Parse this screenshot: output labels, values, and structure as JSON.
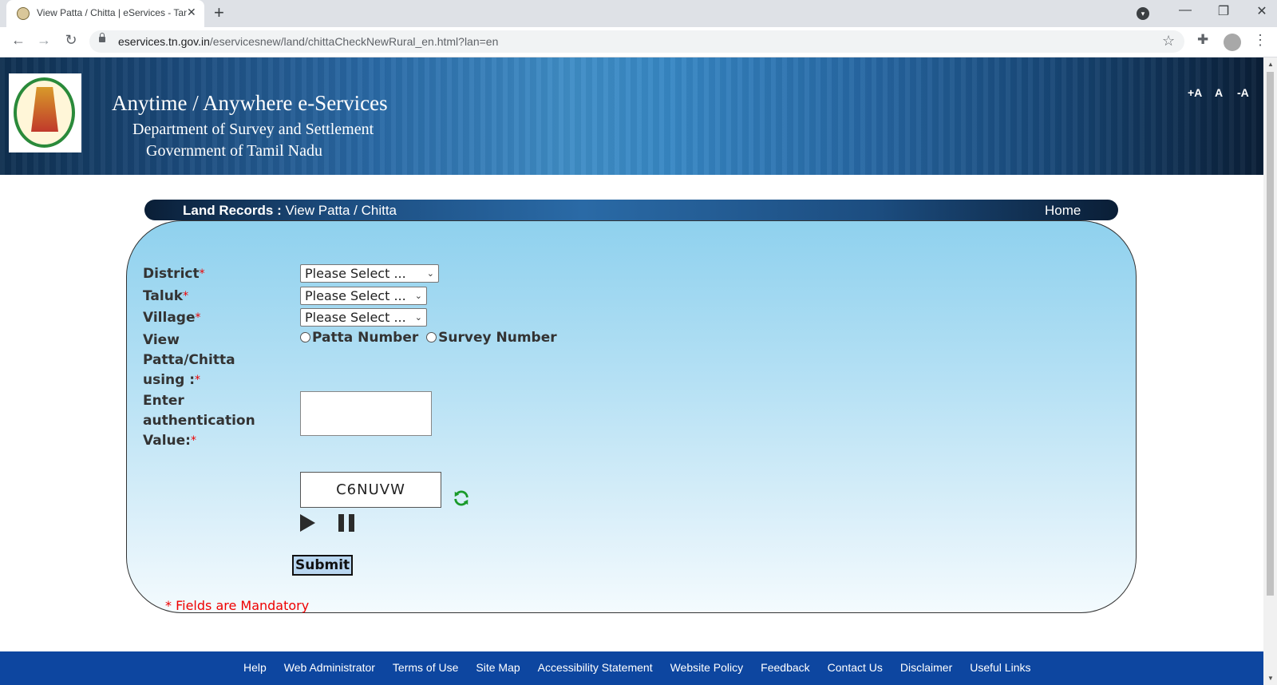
{
  "browser": {
    "tab_title": "View Patta / Chitta | eServices - Tamil Nadu",
    "new_tab": "+",
    "close_tab": "✕",
    "url_host": "eservices.tn.gov.in",
    "url_path": "/eservicesnew/land/chittaCheckNewRural_en.html?lan=en",
    "icons": [
      "back-icon",
      "forward-icon",
      "reload-icon",
      "lock-icon",
      "star-icon",
      "extensions-icon",
      "avatar",
      "kebab-menu-icon",
      "minimize-icon",
      "restore-icon",
      "close-icon"
    ]
  },
  "banner": {
    "title": "Anytime / Anywhere e-Services",
    "subtitle1": "Department of Survey and Settlement",
    "subtitle2": "Government of Tamil Nadu",
    "font_increase": "+A",
    "font_normal": "A",
    "font_decrease": "-A"
  },
  "section": {
    "label_bold": "Land Records :",
    "label_rest": " View Patta / Chitta",
    "home": "Home"
  },
  "form": {
    "district_label": "District",
    "taluk_label": "Taluk",
    "village_label": "Village",
    "view_label": "View Patta/Chitta using :",
    "auth_label": "Enter authentication Value:",
    "required_mark": "*",
    "district_value": "Please Select ...",
    "taluk_value": "Please Select ...",
    "village_value": "Please Select ...",
    "radio_patta": "Patta Number",
    "radio_survey": "Survey Number",
    "captcha": "C6NUVW",
    "submit": "Submit",
    "mandatory_note": "* Fields are Mandatory"
  },
  "footer": {
    "links": [
      "Help",
      "Web Administrator",
      "Terms of Use",
      "Site Map",
      "Accessibility Statement",
      "Website Policy",
      "Feedback",
      "Contact Us",
      "Disclaimer",
      "Useful Links"
    ]
  },
  "colors": {
    "footer_bg": "#0d46a0",
    "required": "#e00000",
    "panel_top": "#8fd1ee",
    "refresh_icon": "#1a9a2a"
  }
}
